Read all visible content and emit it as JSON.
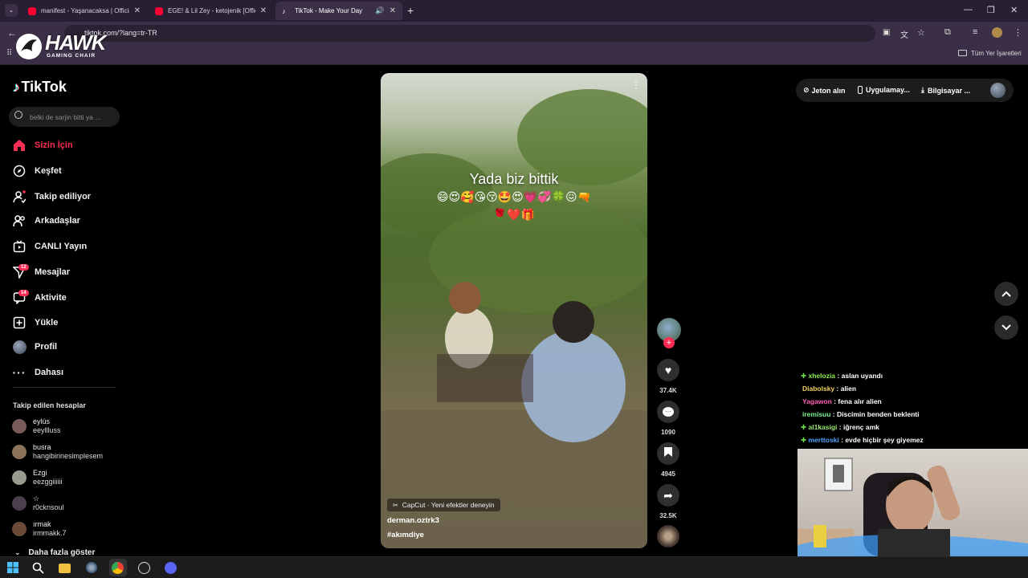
{
  "browser": {
    "tabs": [
      {
        "title": "manifest - Yaşanacaksa | Officia"
      },
      {
        "title": "EGE! & Lil Zey - ketojenik [Offici"
      },
      {
        "title": "TikTok - Make Your Day"
      }
    ],
    "url": "tiktok.com/?lang=tr-TR",
    "bookmarks_label": "Tüm Yer İşaretleri"
  },
  "overlay_logo": {
    "brand": "HAWK",
    "tagline": "GAMING CHAIR"
  },
  "sidebar": {
    "logo": "TikTok",
    "search_placeholder": "belki de sarjin bitti ya ...",
    "nav": [
      {
        "label": "Sizin İçin",
        "icon": "home-icon"
      },
      {
        "label": "Keşfet",
        "icon": "compass-icon"
      },
      {
        "label": "Takip ediliyor",
        "icon": "following-icon"
      },
      {
        "label": "Arkadaşlar",
        "icon": "friends-icon"
      },
      {
        "label": "CANLI Yayın",
        "icon": "live-icon"
      },
      {
        "label": "Mesajlar",
        "icon": "messages-icon",
        "badge": "12"
      },
      {
        "label": "Aktivite",
        "icon": "activity-icon",
        "badge": "14"
      },
      {
        "label": "Yükle",
        "icon": "upload-icon"
      },
      {
        "label": "Profil",
        "icon": "profile-icon"
      },
      {
        "label": "Dahası",
        "icon": "more-icon"
      }
    ],
    "following_title": "Takip edilen hesaplar",
    "following": [
      {
        "name": "eylüs",
        "username": "eeyllluss"
      },
      {
        "name": "busra",
        "username": "hangibirinesimplesem"
      },
      {
        "name": "Ezgi",
        "username": "eezggiiiiii"
      },
      {
        "name": "☆",
        "username": "r0cknsoul"
      },
      {
        "name": "ırmak",
        "username": "irmmakk.7"
      }
    ],
    "show_more": "Daha fazla göster"
  },
  "video": {
    "caption": "Yada biz bittik",
    "emojis_line1": "😄😍🥰😘😚🤩😍💗💞🍀😖🔫",
    "emojis_line2": "🌹❤️🎁",
    "capcut": "CapCut · Yeni efektler deneyin",
    "author": "derman.oztrk3",
    "hashtag": "#akımdiye"
  },
  "actions": {
    "likes": "37.4K",
    "comments": "1090",
    "saves": "4945",
    "shares": "32.5K"
  },
  "header": {
    "coins": "Jeton alın",
    "app": "Uygulamay...",
    "desktop": "Bilgisayar ..."
  },
  "chat": [
    {
      "user": "xhelozia",
      "text": "aslan uyandı",
      "color": "#8ef04f",
      "icon": "✚"
    },
    {
      "user": "Diabolsky",
      "text": "alien",
      "color": "#f5d35c",
      "icon": ""
    },
    {
      "user": "Yagawon",
      "text": "fena alır alien",
      "color": "#ff5fb0",
      "icon": ""
    },
    {
      "user": "iremisuu",
      "text": "Discimin benden beklenti",
      "color": "#7df28f",
      "icon": ""
    },
    {
      "user": "al1kasigi",
      "text": "iğrenç amk",
      "color": "#9be870",
      "icon": "✚"
    },
    {
      "user": "merttoski",
      "text": "evde hiçbir şey giyemez",
      "color": "#4fa3ff",
      "icon": "✚"
    }
  ],
  "colors": {
    "accent": "#fe2c55",
    "chrome": "#3b2f47",
    "tabbar": "#291f33"
  }
}
